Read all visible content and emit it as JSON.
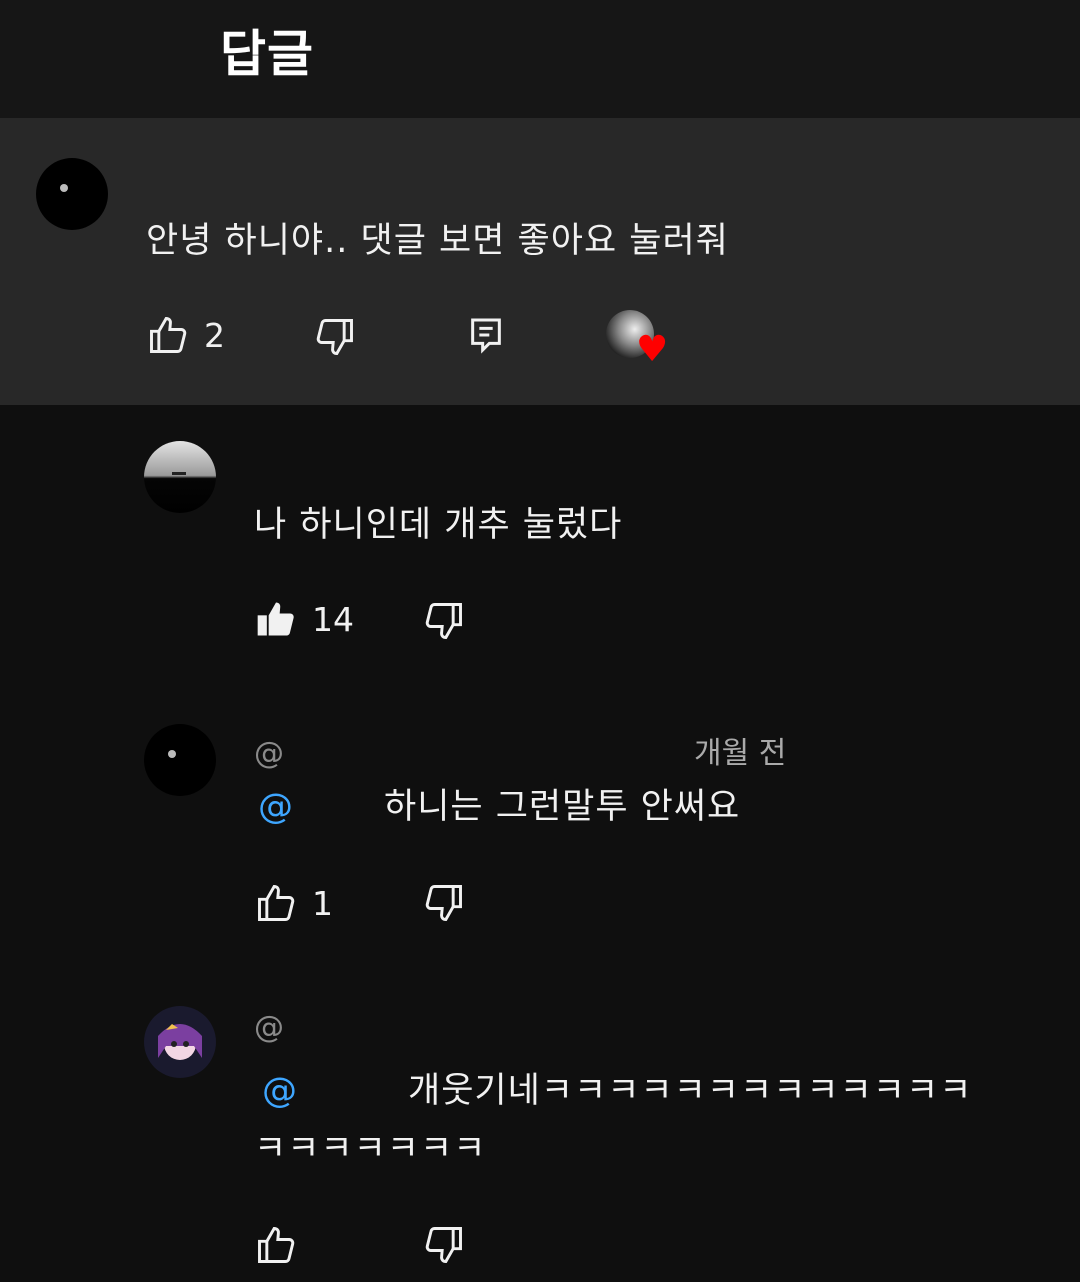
{
  "header": {
    "title": "답글"
  },
  "pinned": {
    "handle": "",
    "text": "안녕 하니야.. 댓글 보면 좋아요 눌러줘",
    "like_count": "2"
  },
  "replies": [
    {
      "handle": "",
      "text": "나 하니인데 개추 눌렀다",
      "like_count": "14",
      "liked": true
    },
    {
      "handle_prefix": "@",
      "time": "개월 전",
      "mention": "@",
      "text": "하니는 그런말투 안써요",
      "like_count": "1",
      "liked": false
    },
    {
      "handle_prefix": "@",
      "mention": "@",
      "text_line1": "개웃기네ㅋㅋㅋㅋㅋㅋㅋㅋㅋㅋㅋㅋㅋ",
      "text_line2": "ㅋㅋㅋㅋㅋㅋㅋ",
      "like_count": "",
      "liked": false
    }
  ],
  "icons": {
    "like": "thumbs-up-icon",
    "dislike": "thumbs-down-icon",
    "reply": "reply-icon",
    "creator_heart": "creator-heart-icon"
  },
  "colors": {
    "mention": "#3ea6ff",
    "heart": "#ff0000",
    "pinned_bg": "#282828"
  }
}
